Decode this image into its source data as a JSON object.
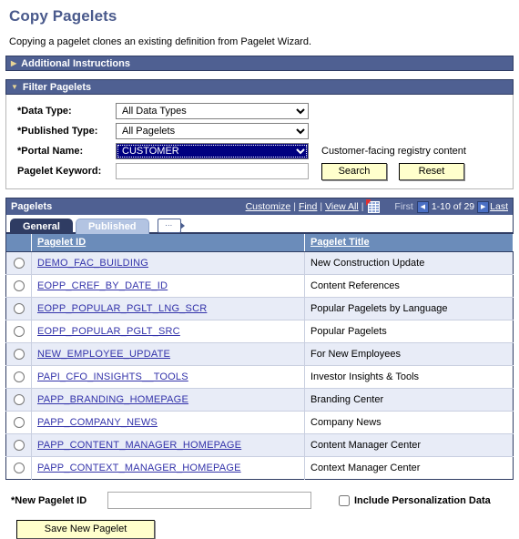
{
  "page": {
    "title": "Copy Pagelets",
    "intro": "Copying a pagelet clones an existing definition from Pagelet Wizard."
  },
  "sections": {
    "additional_instructions": {
      "label": "Additional Instructions",
      "arrow": "collapsed-arrow-icon",
      "glyph": "▶"
    },
    "filter_pagelets": {
      "label": "Filter Pagelets",
      "arrow": "expanded-arrow-icon",
      "glyph": "▼"
    }
  },
  "filter": {
    "data_type": {
      "label": "*Data Type:",
      "value": "All Data Types"
    },
    "published_type": {
      "label": "*Published Type:",
      "value": "All Pagelets"
    },
    "portal_name": {
      "label": "*Portal Name:",
      "value": "CUSTOMER",
      "hint": "Customer-facing registry content"
    },
    "pagelet_keyword": {
      "label": "Pagelet Keyword:",
      "value": "",
      "placeholder": ""
    },
    "search_label": "Search",
    "reset_label": "Reset"
  },
  "grid": {
    "title": "Pagelets",
    "links": {
      "customize": "Customize",
      "find": "Find",
      "view_all": "View All"
    },
    "separator": "|",
    "excel_icon": "download-to-excel-icon",
    "pagination": {
      "first": "First",
      "prev_icon": "◀",
      "range": "1-10 of 29",
      "next_icon": "▶",
      "last": "Last"
    },
    "tabs": [
      {
        "label": "General",
        "active": true
      },
      {
        "label": "Published",
        "active": false
      }
    ],
    "expand_icon": "show-all-columns-icon",
    "columns": [
      "Pagelet ID",
      "Pagelet Title"
    ],
    "rows": [
      {
        "id": "DEMO_FAC_BUILDING",
        "title": "New Construction Update"
      },
      {
        "id": "EOPP_CREF_BY_DATE_ID",
        "title": "Content References"
      },
      {
        "id": "EOPP_POPULAR_PGLT_LNG_SCR",
        "title": "Popular Pagelets by Language"
      },
      {
        "id": "EOPP_POPULAR_PGLT_SRC",
        "title": "Popular Pagelets"
      },
      {
        "id": "NEW_EMPLOYEE_UPDATE",
        "title": "For New Employees"
      },
      {
        "id": "PAPI_CFO_INSIGHTS__TOOLS",
        "title": "Investor Insights & Tools"
      },
      {
        "id": "PAPP_BRANDING_HOMEPAGE",
        "title": "Branding Center"
      },
      {
        "id": "PAPP_COMPANY_NEWS",
        "title": "Company News"
      },
      {
        "id": "PAPP_CONTENT_MANAGER_HOMEPAGE",
        "title": "Content Manager Center"
      },
      {
        "id": "PAPP_CONTEXT_MANAGER_HOMEPAGE",
        "title": "Context Manager Center"
      }
    ]
  },
  "footer": {
    "new_pagelet_id": {
      "label": "*New Pagelet ID",
      "value": "",
      "placeholder": ""
    },
    "include_personalization": {
      "label": "Include Personalization Data",
      "checked": false
    },
    "save_label": "Save New Pagelet"
  },
  "colors": {
    "title": "#4a5a8c",
    "section_bar": "#4f6092",
    "column_header": "#6b8cba",
    "tab_active": "#2f3c63",
    "tab_inactive": "#b3c4e2",
    "row_odd": "#e8ecf7",
    "button": "#ffffcc",
    "link": "#3333aa",
    "select_focus": "#000080"
  }
}
